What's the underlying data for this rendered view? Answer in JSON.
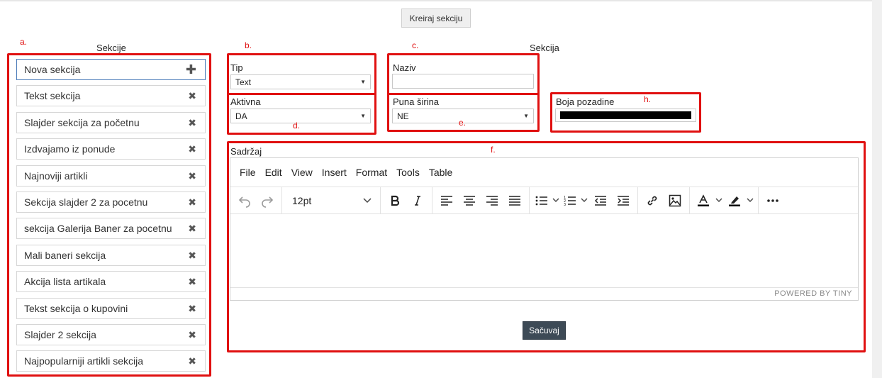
{
  "top": {
    "create_button": "Kreiraj sekciju"
  },
  "markers": {
    "a": "a.",
    "b": "b.",
    "c": "c.",
    "d": "d.",
    "e": "e.",
    "f": "f.",
    "h": "h."
  },
  "sections_panel": {
    "heading": "Sekcije",
    "items": [
      {
        "label": "Nova sekcija",
        "action": "plus"
      },
      {
        "label": "Tekst sekcija",
        "action": "delete"
      },
      {
        "label": "Slajder sekcija za početnu",
        "action": "delete"
      },
      {
        "label": "Izdvajamo iz ponude",
        "action": "delete"
      },
      {
        "label": "Najnoviji artikli",
        "action": "delete"
      },
      {
        "label": "Sekcija slajder 2 za pocetnu",
        "action": "delete"
      },
      {
        "label": "sekcija Galerija Baner za pocetnu",
        "action": "delete"
      },
      {
        "label": "Mali baneri sekcija",
        "action": "delete"
      },
      {
        "label": "Akcija lista artikala",
        "action": "delete"
      },
      {
        "label": "Tekst sekcija o kupovini",
        "action": "delete"
      },
      {
        "label": "Slajder 2 sekcija",
        "action": "delete"
      },
      {
        "label": "Najpopularniji artikli sekcija",
        "action": "delete"
      }
    ],
    "plus_glyph": "✚",
    "delete_glyph": "✖"
  },
  "section_form": {
    "heading": "Sekcija",
    "tip": {
      "label": "Tip",
      "value": "Text"
    },
    "naziv": {
      "label": "Naziv",
      "value": ""
    },
    "aktivna": {
      "label": "Aktivna",
      "value": "DA"
    },
    "puna_sirina": {
      "label": "Puna širina",
      "value": "NE"
    },
    "boja_pozadine": {
      "label": "Boja pozadine",
      "color": "#000000"
    },
    "sadrzaj": {
      "label": "Sadržaj"
    }
  },
  "editor": {
    "menu": [
      "File",
      "Edit",
      "View",
      "Insert",
      "Format",
      "Tools",
      "Table"
    ],
    "font_size": "12pt",
    "powered_by": "POWERED BY TINY"
  },
  "save_button": "Sačuvaj",
  "colors": {
    "highlight": "#e01010",
    "save_bg": "#3d4a56",
    "focus_border": "#4a7ab8"
  }
}
